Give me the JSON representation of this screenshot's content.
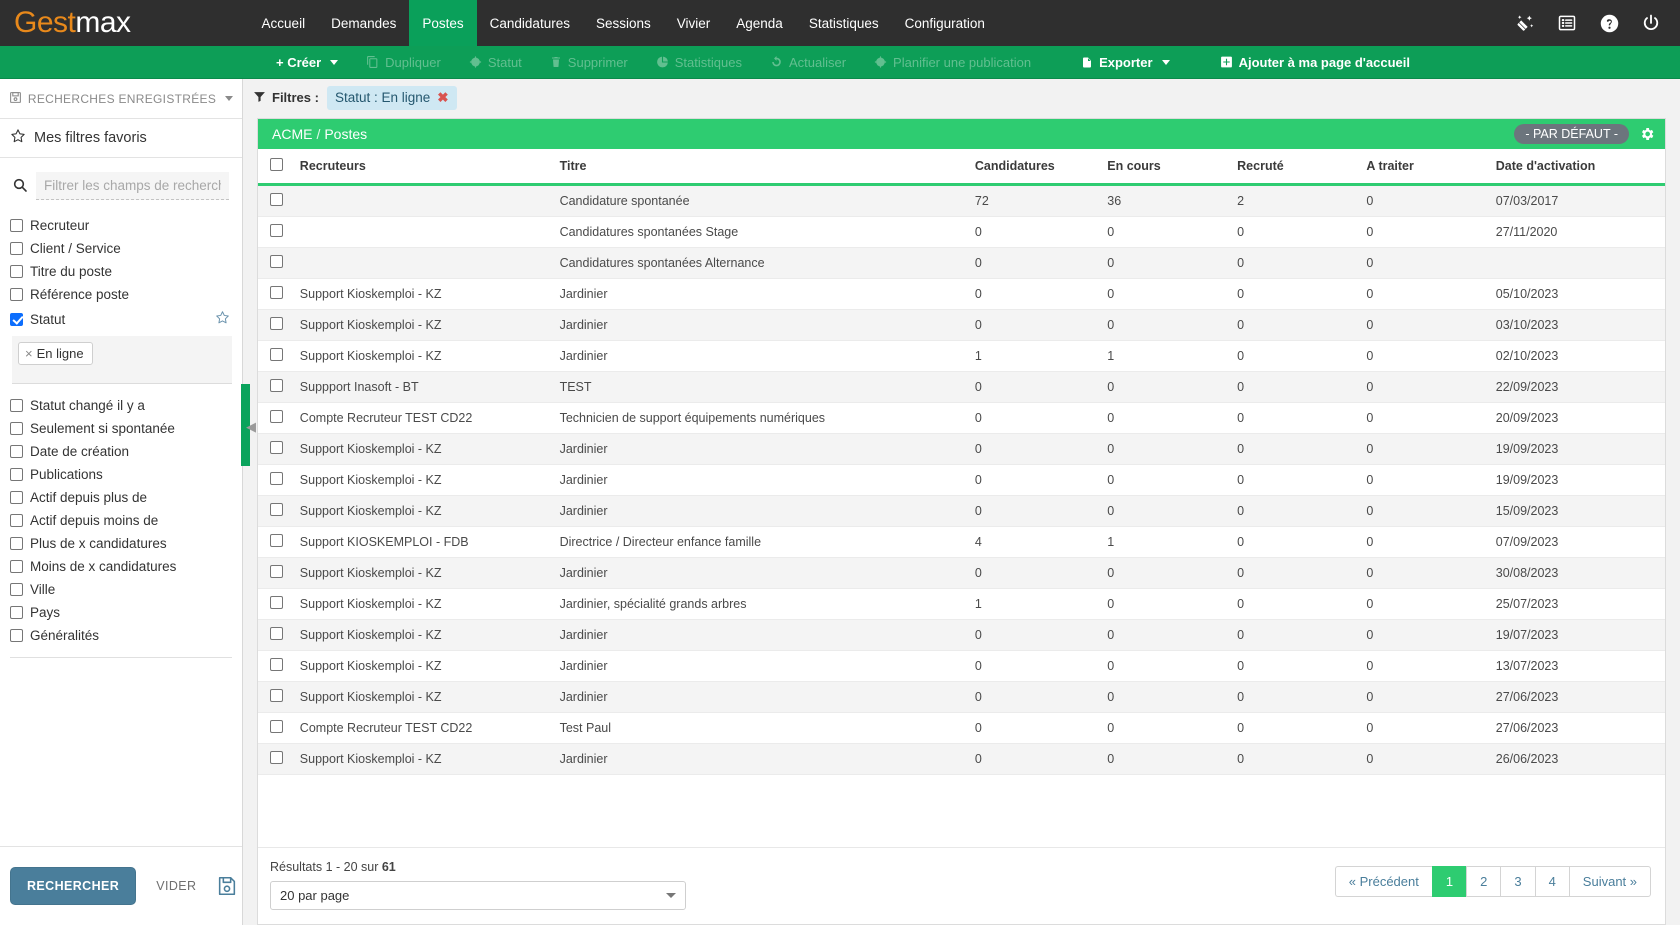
{
  "brand": {
    "first": "Gest",
    "second": "max"
  },
  "nav": {
    "items": [
      {
        "label": "Accueil",
        "active": false
      },
      {
        "label": "Demandes",
        "active": false
      },
      {
        "label": "Postes",
        "active": true
      },
      {
        "label": "Candidatures",
        "active": false
      },
      {
        "label": "Sessions",
        "active": false
      },
      {
        "label": "Vivier",
        "active": false
      },
      {
        "label": "Agenda",
        "active": false
      },
      {
        "label": "Statistiques",
        "active": false
      },
      {
        "label": "Configuration",
        "active": false
      }
    ],
    "right_icons": [
      "magic-wand-icon",
      "list-view-icon",
      "help-icon",
      "power-icon"
    ]
  },
  "toolbar": {
    "create_label": "+ Créer",
    "duplicate_label": "Dupliquer",
    "status_label": "Statut",
    "delete_label": "Supprimer",
    "stats_label": "Statistiques",
    "refresh_label": "Actualiser",
    "schedule_label": "Planifier une publication",
    "export_label": "Exporter",
    "addhome_label": "Ajouter à ma page d'accueil"
  },
  "sidebar": {
    "saved_searches": "RECHERCHES ENREGISTRÉES",
    "favorite_filters": "Mes filtres favoris",
    "search_placeholder": "Filtrer les champs de recherche",
    "search_value": "",
    "filters_top": [
      {
        "label": "Recruteur",
        "checked": false,
        "star": false
      },
      {
        "label": "Client / Service",
        "checked": false,
        "star": false
      },
      {
        "label": "Titre du poste",
        "checked": false,
        "star": false
      },
      {
        "label": "Référence poste",
        "checked": false,
        "star": false
      },
      {
        "label": "Statut",
        "checked": true,
        "star": true
      }
    ],
    "statut_tag": "En ligne",
    "filters_bottom": [
      {
        "label": "Statut changé il y a",
        "checked": false
      },
      {
        "label": "Seulement si spontanée",
        "checked": false
      },
      {
        "label": "Date de création",
        "checked": false
      },
      {
        "label": "Publications",
        "checked": false
      },
      {
        "label": "Actif depuis plus de",
        "checked": false
      },
      {
        "label": "Actif depuis moins de",
        "checked": false
      },
      {
        "label": "Plus de x candidatures",
        "checked": false
      },
      {
        "label": "Moins de x candidatures",
        "checked": false
      },
      {
        "label": "Ville",
        "checked": false
      },
      {
        "label": "Pays",
        "checked": false
      },
      {
        "label": "Généralités",
        "checked": false
      }
    ],
    "search_button": "RECHERCHER",
    "clear_button": "VIDER"
  },
  "filters_bar": {
    "label": "Filtres :",
    "chip": "Statut : En ligne"
  },
  "panel": {
    "breadcrumb_root": "ACME",
    "breadcrumb_sep": "/",
    "breadcrumb_current": "Postes",
    "default_badge": "- PAR DÉFAUT -"
  },
  "table": {
    "headers": [
      "Recruteurs",
      "Titre",
      "Candidatures",
      "En cours",
      "Recruté",
      "A traiter",
      "Date d'activation"
    ],
    "rows": [
      {
        "recruteur": "",
        "titre": "Candidature spontanée",
        "candidatures": "72",
        "en_cours": "36",
        "recrute": "2",
        "a_traiter": "0",
        "date": "07/03/2017"
      },
      {
        "recruteur": "",
        "titre": "Candidatures spontanées Stage",
        "candidatures": "0",
        "en_cours": "0",
        "recrute": "0",
        "a_traiter": "0",
        "date": "27/11/2020"
      },
      {
        "recruteur": "",
        "titre": "Candidatures spontanées Alternance",
        "candidatures": "0",
        "en_cours": "0",
        "recrute": "0",
        "a_traiter": "0",
        "date": ""
      },
      {
        "recruteur": "Support Kioskemploi - KZ",
        "titre": "Jardinier",
        "candidatures": "0",
        "en_cours": "0",
        "recrute": "0",
        "a_traiter": "0",
        "date": "05/10/2023"
      },
      {
        "recruteur": "Support Kioskemploi - KZ",
        "titre": "Jardinier",
        "candidatures": "0",
        "en_cours": "0",
        "recrute": "0",
        "a_traiter": "0",
        "date": "03/10/2023"
      },
      {
        "recruteur": "Support Kioskemploi - KZ",
        "titre": "Jardinier",
        "candidatures": "1",
        "en_cours": "1",
        "recrute": "0",
        "a_traiter": "0",
        "date": "02/10/2023"
      },
      {
        "recruteur": "Suppport Inasoft - BT",
        "titre": "TEST",
        "candidatures": "0",
        "en_cours": "0",
        "recrute": "0",
        "a_traiter": "0",
        "date": "22/09/2023"
      },
      {
        "recruteur": "Compte Recruteur TEST CD22",
        "titre": "Technicien de support équipements numériques",
        "candidatures": "0",
        "en_cours": "0",
        "recrute": "0",
        "a_traiter": "0",
        "date": "20/09/2023"
      },
      {
        "recruteur": "Support Kioskemploi - KZ",
        "titre": "Jardinier",
        "candidatures": "0",
        "en_cours": "0",
        "recrute": "0",
        "a_traiter": "0",
        "date": "19/09/2023"
      },
      {
        "recruteur": "Support Kioskemploi - KZ",
        "titre": "Jardinier",
        "candidatures": "0",
        "en_cours": "0",
        "recrute": "0",
        "a_traiter": "0",
        "date": "19/09/2023"
      },
      {
        "recruteur": "Support Kioskemploi - KZ",
        "titre": "Jardinier",
        "candidatures": "0",
        "en_cours": "0",
        "recrute": "0",
        "a_traiter": "0",
        "date": "15/09/2023"
      },
      {
        "recruteur": "Support KIOSKEMPLOI - FDB",
        "titre": "Directrice / Directeur enfance famille",
        "candidatures": "4",
        "en_cours": "1",
        "recrute": "0",
        "a_traiter": "0",
        "date": "07/09/2023"
      },
      {
        "recruteur": "Support Kioskemploi - KZ",
        "titre": "Jardinier",
        "candidatures": "0",
        "en_cours": "0",
        "recrute": "0",
        "a_traiter": "0",
        "date": "30/08/2023"
      },
      {
        "recruteur": "Support Kioskemploi - KZ",
        "titre": "Jardinier, spécialité grands arbres",
        "candidatures": "1",
        "en_cours": "0",
        "recrute": "0",
        "a_traiter": "0",
        "date": "25/07/2023"
      },
      {
        "recruteur": "Support Kioskemploi - KZ",
        "titre": "Jardinier",
        "candidatures": "0",
        "en_cours": "0",
        "recrute": "0",
        "a_traiter": "0",
        "date": "19/07/2023"
      },
      {
        "recruteur": "Support Kioskemploi - KZ",
        "titre": "Jardinier",
        "candidatures": "0",
        "en_cours": "0",
        "recrute": "0",
        "a_traiter": "0",
        "date": "13/07/2023"
      },
      {
        "recruteur": "Support Kioskemploi - KZ",
        "titre": "Jardinier",
        "candidatures": "0",
        "en_cours": "0",
        "recrute": "0",
        "a_traiter": "0",
        "date": "27/06/2023"
      },
      {
        "recruteur": "Compte Recruteur TEST CD22",
        "titre": "Test Paul",
        "candidatures": "0",
        "en_cours": "0",
        "recrute": "0",
        "a_traiter": "0",
        "date": "27/06/2023"
      },
      {
        "recruteur": "Support Kioskemploi - KZ",
        "titre": "Jardinier",
        "candidatures": "0",
        "en_cours": "0",
        "recrute": "0",
        "a_traiter": "0",
        "date": "26/06/2023"
      }
    ]
  },
  "footer": {
    "results_prefix": "Résultats 1 - 20 sur ",
    "results_total": "61",
    "per_page": "20 par page",
    "pager": [
      {
        "label": "« Précédent",
        "active": false
      },
      {
        "label": "1",
        "active": true
      },
      {
        "label": "2",
        "active": false
      },
      {
        "label": "3",
        "active": false
      },
      {
        "label": "4",
        "active": false
      },
      {
        "label": "Suivant »",
        "active": false
      }
    ]
  },
  "colors": {
    "brand_orange": "#e8891b",
    "nav_dark": "#2f2f2f",
    "green_active": "#0aa05a",
    "toolbar_green": "#0d9e57",
    "panel_green": "#2ecc71",
    "primary_blue": "#4a7e9b",
    "chip_blue": "#cfe8f3"
  }
}
